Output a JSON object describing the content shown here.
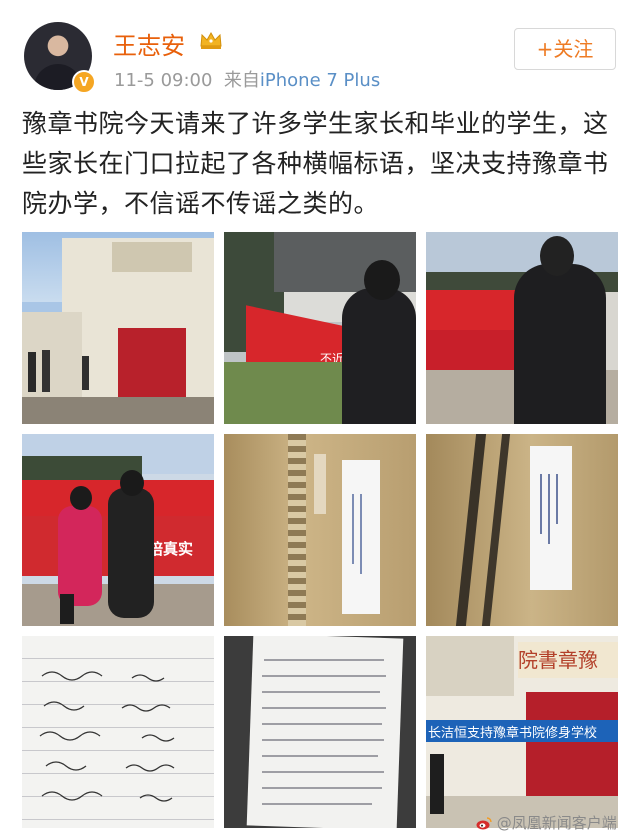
{
  "user": {
    "name": "王志安",
    "verified_badge": "V",
    "crown_icon": "crown-icon"
  },
  "meta": {
    "time": "11-5 09:00",
    "source_prefix": "来自",
    "device": "iPhone 7 Plus"
  },
  "follow_button": "+关注",
  "post_text": "豫章书院今天请来了许多学生家长和毕业的学生，这些家长在门口拉起了各种横幅标语，坚决支持豫章书院办学，不信谣不传谣之类的。",
  "photos": [
    {
      "subject": "school-gate"
    },
    {
      "subject": "man-by-red-banner"
    },
    {
      "subject": "man-by-banners"
    },
    {
      "subject": "parents-with-banners"
    },
    {
      "subject": "notice-on-door"
    },
    {
      "subject": "notice-on-door-closeup"
    },
    {
      "subject": "signature-sheet"
    },
    {
      "subject": "handwritten-letter"
    },
    {
      "subject": "gate-with-blue-banner"
    }
  ],
  "photo_texts": {
    "gate_plaque": "院書章豫",
    "blue_banner": "长洁恒支持豫章书院修身学校",
    "banner_slogan_1": "不近",
    "banner_slogan_2": "陪真实"
  },
  "credit": "@凤凰新闻客户端",
  "colors": {
    "username": "#e8600b",
    "follow": "#ee7b24",
    "device_link": "#5a8fc6",
    "banner_red": "#d7262b"
  }
}
